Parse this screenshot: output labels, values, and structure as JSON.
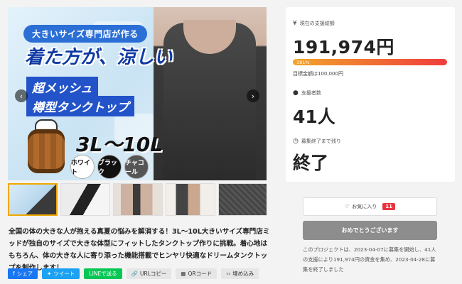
{
  "hero": {
    "badge": "大きいサイズ専門店が作る",
    "headline": "着た方が、涼しい",
    "sub1": "超メッシュ",
    "sub2": "樽型タンクトップ",
    "size_range": "3L〜10L",
    "colors": [
      "ホワイト",
      "ブラック",
      "チャコール"
    ],
    "prev": "‹",
    "next": "›"
  },
  "description": "全国の体の大きな人が抱える真夏の悩みを解消する！3L〜10L大きいサイズ専門店ミッドが独自のサイズで大きな体型にフィットしたタンクトップ作りに挑戦。着心地はもちろん、体の大きな人に寄り添った機能搭載でヒンヤリ快適なドリームタンクトップを制作します！",
  "share": {
    "facebook": "シェア",
    "twitter": "ツイート",
    "line": "LINEで送る",
    "url": "URLコピー",
    "qr": "QRコード",
    "embed": "埋め込み"
  },
  "stats": {
    "total_label": "現在の支援総額",
    "total_amount": "191,974円",
    "percent": "191%",
    "percent_value": 191,
    "goal_text": "目標金額は100,000円",
    "supporters_label": "支援者数",
    "supporters": "41人",
    "remaining_label": "募集終了まで残り",
    "remaining": "終了"
  },
  "actions": {
    "favorite_label": "お気に入り",
    "favorite_count": "11",
    "finished_button": "おめでとうございます"
  },
  "project_info": "このプロジェクトは、2023-04-07に募集を開始し、41人の支援により191,974円の資金を集め、2023-04-28に募集を終了しました",
  "icons": {
    "yen": "yen-icon",
    "person": "person-icon",
    "clock": "clock-icon",
    "heart": "heart-icon"
  },
  "colors": {
    "accent_gradient_start": "#f3a42b",
    "accent_gradient_end": "#ef3c3c",
    "badge_red": "#e8343f",
    "button_gray": "#8d8d8d"
  }
}
